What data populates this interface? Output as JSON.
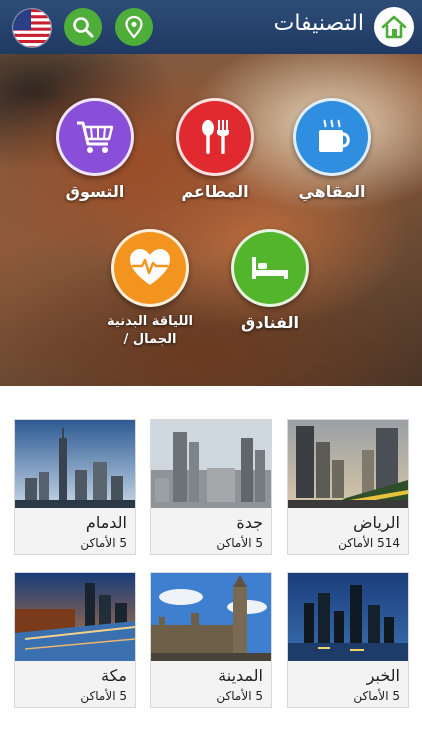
{
  "header": {
    "title": "التصنيفات",
    "colors": {
      "bar": "#2d4d78",
      "accent_green": "#4fae3a"
    },
    "icons": [
      "home-icon",
      "search-icon",
      "location-pin-icon",
      "us-flag-icon"
    ]
  },
  "categories": [
    {
      "label": "المقاهي",
      "icon": "coffee-cup-icon",
      "color": "#2f8ee0"
    },
    {
      "label": "المطاعم",
      "icon": "fork-spoon-icon",
      "color": "#e02a2f"
    },
    {
      "label": "التسوق",
      "icon": "shopping-cart-icon",
      "color": "#8a4fd8"
    },
    {
      "label": "الفنادق",
      "icon": "bed-icon",
      "color": "#52b52c"
    },
    {
      "label_line1": "اللياقة البدنية",
      "label_line2": "الجمال /",
      "icon": "heart-pulse-icon",
      "color": "#f3941e"
    }
  ],
  "cities": [
    {
      "name": "الرياض",
      "count": "514 الأماكن"
    },
    {
      "name": "جدة",
      "count": "5 الأماكن"
    },
    {
      "name": "الدمام",
      "count": "5 الأماكن"
    },
    {
      "name": "الخبر",
      "count": "5 الأماكن"
    },
    {
      "name": "المدينة",
      "count": "5 الأماكن"
    },
    {
      "name": "مكة",
      "count": "5 الأماكن"
    }
  ]
}
